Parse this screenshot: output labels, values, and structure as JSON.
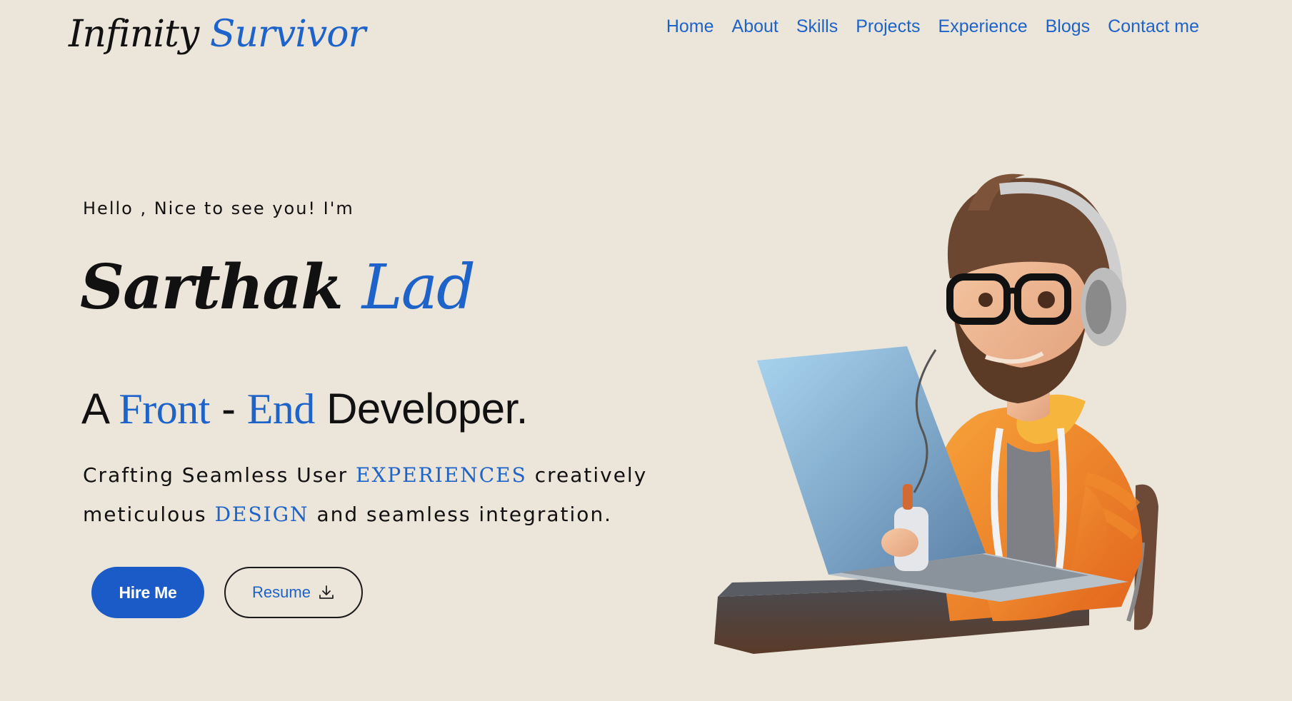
{
  "header": {
    "logo_part1": "Infinity",
    "logo_part2": "Survivor",
    "nav": [
      "Home",
      "About",
      "Skills",
      "Projects",
      "Experience",
      "Blogs",
      "Contact me"
    ]
  },
  "hero": {
    "greeting": "Hello , Nice to see you! I'm",
    "first_name": "Sarthak",
    "last_name": "Lad",
    "role": {
      "a": "A",
      "front": "Front",
      "dash": "-",
      "end": "End",
      "developer": "Developer."
    },
    "tagline": {
      "part1": "Crafting Seamless User",
      "experiences": "EXPERIENCES",
      "part2": "creatively meticulous",
      "design": "DESIGN",
      "part3": "and seamless integration."
    },
    "hire_button": "Hire Me",
    "resume_button": "Resume"
  },
  "icons": {
    "resume": "download-icon"
  },
  "colors": {
    "background": "#ebe5da",
    "accent": "#1e63c9",
    "text": "#111111"
  }
}
